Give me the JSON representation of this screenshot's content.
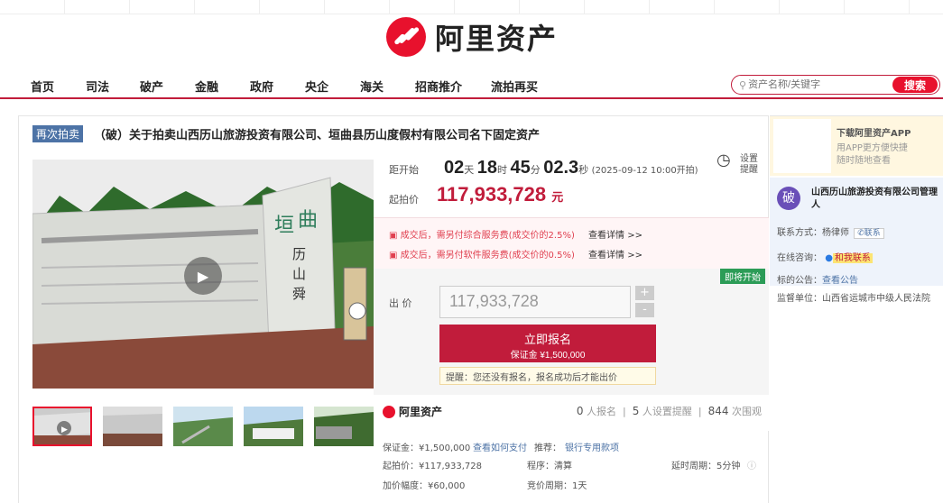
{
  "brand": {
    "name": "阿里资产",
    "color": "#e8112d"
  },
  "nav": {
    "items": [
      "首页",
      "司法",
      "破产",
      "金融",
      "政府",
      "央企",
      "海关",
      "招商推介",
      "流拍再买"
    ]
  },
  "search": {
    "placeholder": "资产名称/关键字",
    "button": "搜索"
  },
  "listing": {
    "tag": "再次拍卖",
    "title": "（破）关于拍卖山西历山旅游投资有限公司、垣曲县历山度假村有限公司名下固定资产"
  },
  "countdown": {
    "label": "距开始",
    "days": "02",
    "days_unit": "天",
    "hours": "18",
    "hours_unit": "时",
    "minutes": "45",
    "minutes_unit": "分",
    "seconds": "02.3",
    "seconds_unit": "秒",
    "start_note": "(2025-09-12 10:00开拍)"
  },
  "reminder": {
    "line1": "设置",
    "line2": "提醒",
    "icon": "alarm-clock-icon"
  },
  "start_price": {
    "label": "起拍价",
    "value": "117,933,728",
    "unit": "元"
  },
  "fees": [
    {
      "text": "成交后，需另付综合服务费(成交价的2.5%)",
      "link": "查看详情 >>"
    },
    {
      "text": "成交后，需另付软件服务费(成交价的0.5%)",
      "link": "查看详情 >>"
    }
  ],
  "bid": {
    "badge": "即将开始",
    "label": "出  价",
    "value": "117,933,728",
    "plus": "+",
    "minus": "-",
    "signup_label": "立即报名",
    "deposit_line": "保证金 ¥1,500,000",
    "tip": "提醒：您还没有报名，报名成功后才能出价"
  },
  "stats": {
    "brand": "阿里资产",
    "signups": "0",
    "signups_label": "人报名",
    "reminders": "5",
    "reminders_label": "人设置提醒",
    "views": "844",
    "views_label": "次围观"
  },
  "details": {
    "deposit": "保证金：¥1,500,000",
    "how_to_pay": "查看如何支付",
    "recommend": "推荐：",
    "bank": "银行专用款项",
    "start_price": "起拍价：¥117,933,728",
    "procedure": "程序：清算",
    "delay": "延时周期：5分钟",
    "increment": "加价幅度：¥60,000",
    "cycle": "竞价周期：1天"
  },
  "side": {
    "app_title": "下载阿里资产APP",
    "app_sub1": "用APP更方便快捷",
    "app_sub2": "随时随地查看",
    "org_icon": "破",
    "org_name": "山西历山旅游投资有限公司管理人",
    "contact_label": "联系方式：",
    "contact_name": "杨律师",
    "contact_chip": "联系",
    "consult_label": "在线咨询：",
    "consult_btn": "和我联系",
    "notice_label": "标的公告：",
    "notice_link": "查看公告",
    "supervisor_label": "监督单位：",
    "supervisor": "山西省运城市中级人民法院"
  }
}
